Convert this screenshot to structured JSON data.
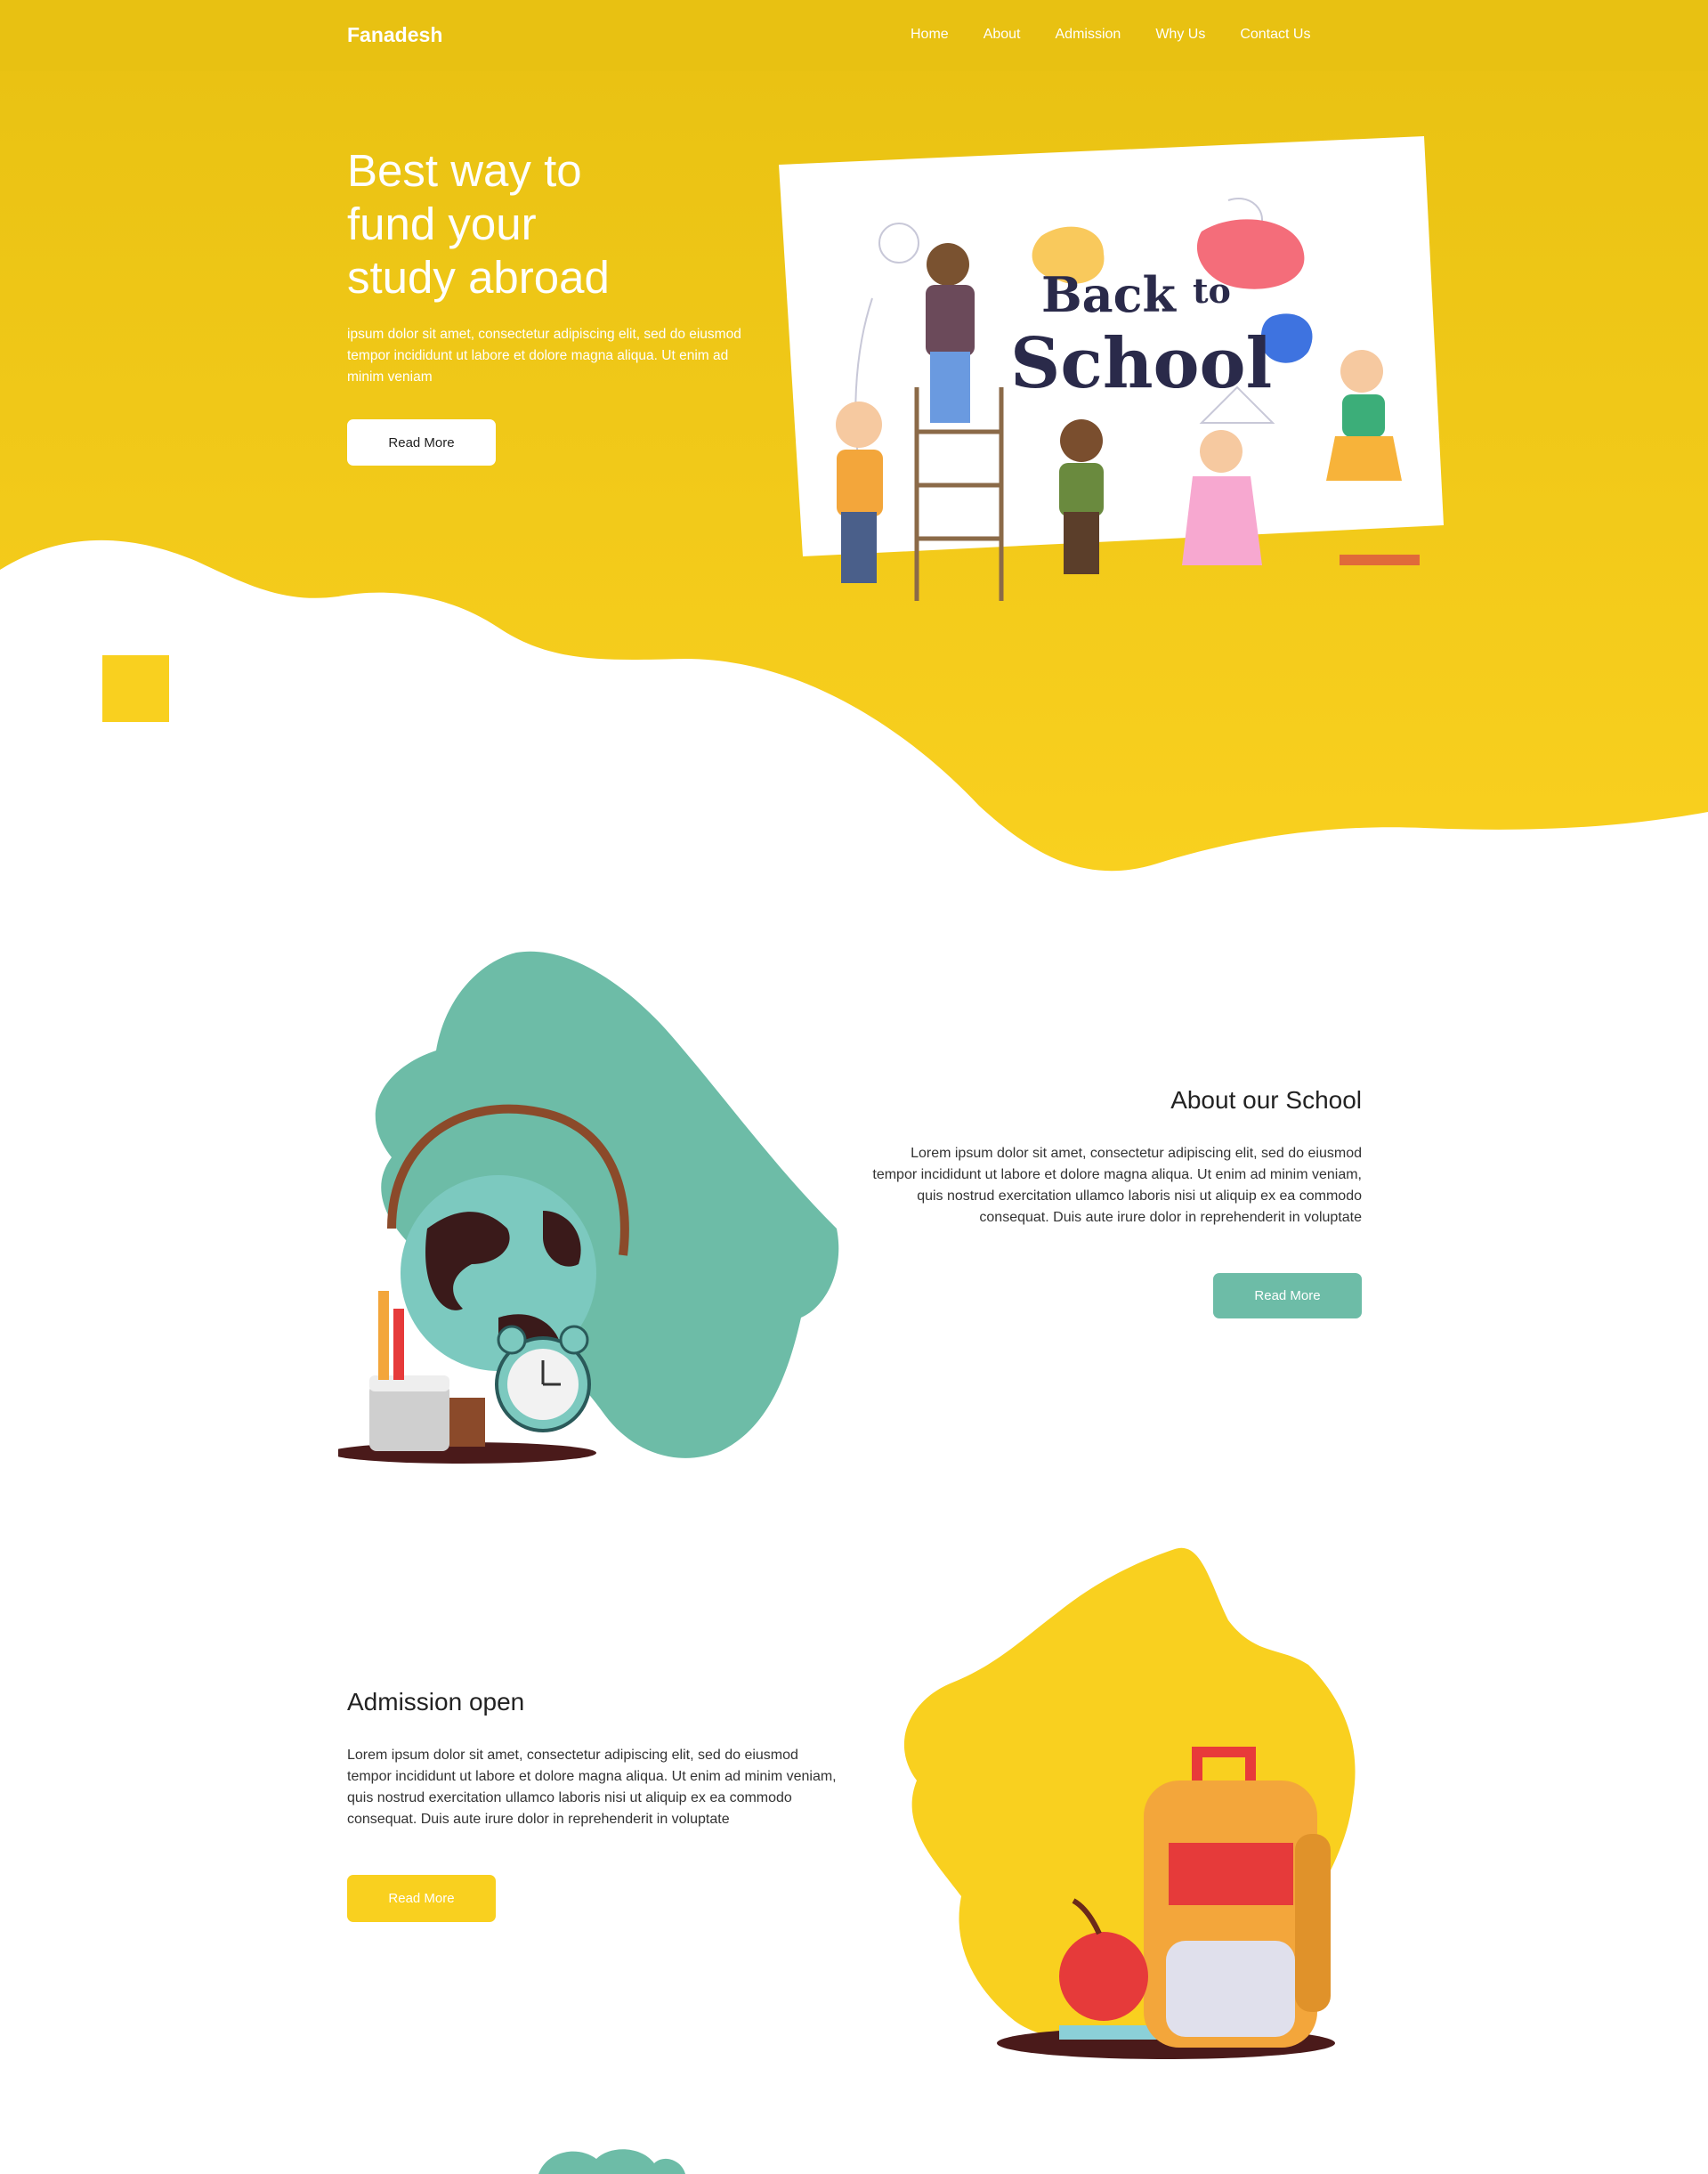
{
  "header": {
    "brand": "Fanadesh",
    "nav": [
      "Home",
      "About",
      "Admission",
      "Why Us",
      "Contact Us"
    ]
  },
  "hero": {
    "title_lines": [
      "Best way to",
      "fund your",
      "study abroad"
    ],
    "description": "ipsum dolor sit amet, consectetur adipiscing elit, sed do eiusmod tempor incididunt ut labore et dolore magna aliqua. Ut enim ad minim veniam",
    "button": "Read More",
    "illustration_text": [
      "Back",
      "to",
      "School"
    ]
  },
  "about": {
    "title": "About our School",
    "text": "Lorem ipsum dolor sit amet, consectetur adipiscing elit, sed do eiusmod tempor incididunt ut labore et dolore magna aliqua. Ut enim ad minim veniam, quis nostrud exercitation ullamco laboris nisi ut aliquip ex ea commodo consequat. Duis aute irure dolor in reprehenderit in voluptate",
    "button": "Read More"
  },
  "admission": {
    "title": "Admission open",
    "text": "Lorem ipsum dolor sit amet, consectetur adipiscing elit, sed do eiusmod tempor incididunt ut labore et dolore magna aliqua. Ut enim ad minim veniam, quis nostrud exercitation ullamco laboris nisi ut aliquip ex ea commodo consequat. Duis aute irure dolor in reprehenderit in voluptate",
    "button": "Read More"
  },
  "colors": {
    "primary_yellow": "#f6c915",
    "accent_yellow": "#f9d01f",
    "teal": "#6dbca7",
    "nav_bg": "#e8c112"
  }
}
